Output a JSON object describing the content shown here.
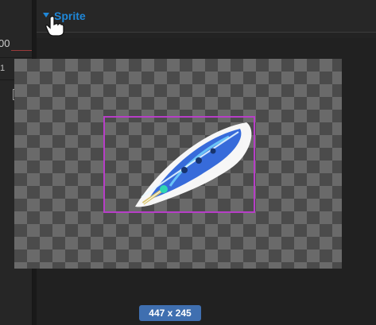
{
  "left_panel": {
    "value_fragment": "00",
    "small_fragment": "1",
    "icons": [
      "menu-icon",
      "dropdown-icon"
    ]
  },
  "sprite_section": {
    "title": "Sprite",
    "expanded": true,
    "toggle_icon": "triangle-down-icon"
  },
  "preview": {
    "background": "checkerboard",
    "bounds_color": "#b73ec7",
    "subject": "feather",
    "size_label": "447 x 245"
  },
  "colors": {
    "accent": "#1f87d8",
    "badge": "#3f6fb0"
  },
  "cursor": "hand-pointer-icon"
}
